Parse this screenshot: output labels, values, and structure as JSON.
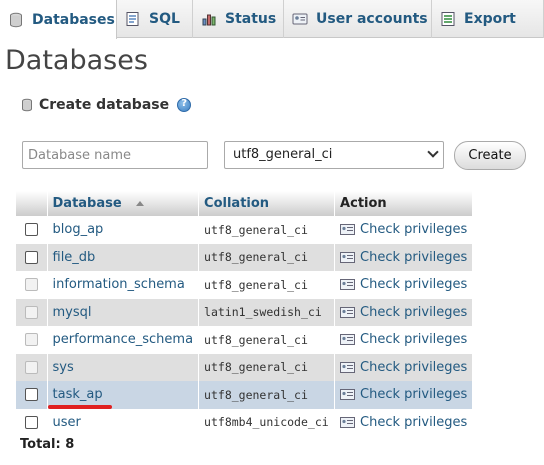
{
  "tabs": [
    {
      "label": "Databases",
      "icon": "database-icon",
      "active": true
    },
    {
      "label": "SQL",
      "icon": "sql-icon"
    },
    {
      "label": "Status",
      "icon": "status-icon"
    },
    {
      "label": "User accounts",
      "icon": "user-accounts-icon"
    },
    {
      "label": "Export",
      "icon": "export-icon"
    }
  ],
  "page": {
    "title": "Databases"
  },
  "create": {
    "heading": "Create database",
    "name_placeholder": "Database name",
    "collation_value": "utf8_general_ci",
    "button_label": "Create"
  },
  "table": {
    "headers": {
      "database": "Database",
      "collation": "Collation",
      "action": "Action"
    },
    "rows": [
      {
        "name": "blog_ap",
        "collation": "utf8_general_ci",
        "action": "Check privileges",
        "checkbox_enabled": true
      },
      {
        "name": "file_db",
        "collation": "utf8_general_ci",
        "action": "Check privileges",
        "checkbox_enabled": true
      },
      {
        "name": "information_schema",
        "collation": "utf8_general_ci",
        "action": "Check privileges",
        "checkbox_enabled": false
      },
      {
        "name": "mysql",
        "collation": "latin1_swedish_ci",
        "action": "Check privileges",
        "checkbox_enabled": false
      },
      {
        "name": "performance_schema",
        "collation": "utf8_general_ci",
        "action": "Check privileges",
        "checkbox_enabled": false
      },
      {
        "name": "sys",
        "collation": "utf8_general_ci",
        "action": "Check privileges",
        "checkbox_enabled": false
      },
      {
        "name": "task_ap",
        "collation": "utf8_general_ci",
        "action": "Check privileges",
        "checkbox_enabled": true,
        "highlighted": true
      },
      {
        "name": "user",
        "collation": "utf8mb4_unicode_ci",
        "action": "Check privileges",
        "checkbox_enabled": true
      }
    ],
    "total": "Total: 8"
  },
  "colors": {
    "link": "#235a81",
    "highlight_row": "#c9d6e4",
    "annotation_underline": "#e02020"
  }
}
